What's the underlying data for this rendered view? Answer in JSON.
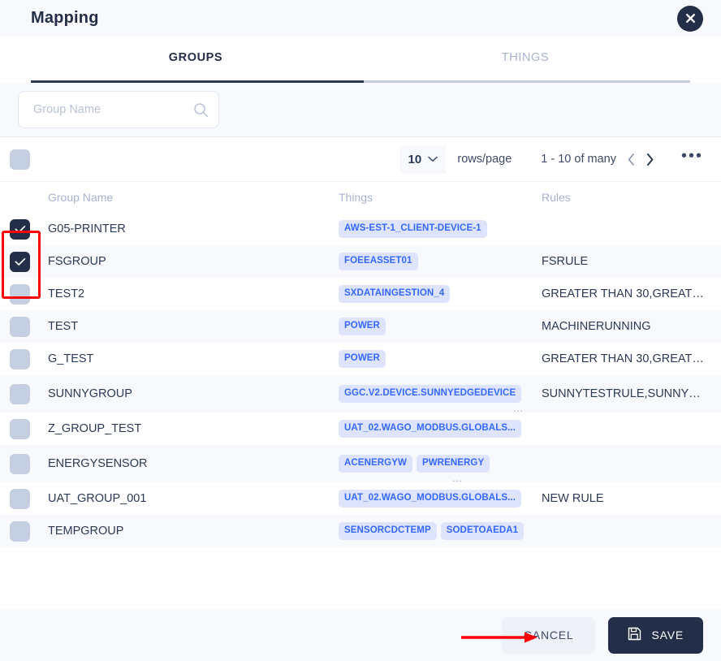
{
  "header": {
    "title": "Mapping",
    "close_icon": "close-icon"
  },
  "tabs": [
    {
      "label": "GROUPS",
      "active": true
    },
    {
      "label": "THINGS",
      "active": false
    }
  ],
  "search": {
    "placeholder": "Group Name",
    "value": "",
    "icon": "search-icon"
  },
  "toolbar": {
    "rows_per_page_value": "10",
    "rows_per_page_label": "rows/page",
    "page_range": "1 - 10 of many",
    "prev_icon": "chevron-left-icon",
    "next_icon": "chevron-right-icon",
    "more_icon": "ellipsis-icon",
    "more_label": "•••"
  },
  "table": {
    "columns": [
      "Group Name",
      "Things",
      "Rules"
    ],
    "rows": [
      {
        "checked": true,
        "group": "G05-PRINTER",
        "things": [
          "AWS-EST-1_CLIENT-DEVICE-1"
        ],
        "overflow": false,
        "rules": ""
      },
      {
        "checked": true,
        "group": "FSGROUP",
        "things": [
          "FOEEASSET01"
        ],
        "overflow": false,
        "rules": "FSRULE"
      },
      {
        "checked": false,
        "group": "TEST2",
        "things": [
          "SXDATAINGESTION_4"
        ],
        "overflow": false,
        "rules": "GREATER THAN 30,GREATE..."
      },
      {
        "checked": false,
        "group": "TEST",
        "things": [
          "POWER"
        ],
        "overflow": false,
        "rules": "MACHINERUNNING"
      },
      {
        "checked": false,
        "group": "G_TEST",
        "things": [
          "POWER"
        ],
        "overflow": false,
        "rules": "GREATER THAN 30,GREATE..."
      },
      {
        "checked": false,
        "group": "SUNNYGROUP",
        "things": [
          "GGC.V2.DEVICE.SUNNYEDGEDEVICE"
        ],
        "overflow": true,
        "rules": "SUNNYTESTRULE,SUNNYTE..."
      },
      {
        "checked": false,
        "group": "Z_GROUP_TEST",
        "things": [
          "UAT_02.WAGO_MODBUS.GLOBALS..."
        ],
        "overflow": false,
        "rules": ""
      },
      {
        "checked": false,
        "group": "ENERGYSENSOR",
        "things": [
          "ACENERGYW",
          "PWRENERGY"
        ],
        "overflow": true,
        "rules": ""
      },
      {
        "checked": false,
        "group": "UAT_GROUP_001",
        "things": [
          "UAT_02.WAGO_MODBUS.GLOBALS..."
        ],
        "overflow": false,
        "rules": "NEW RULE"
      },
      {
        "checked": false,
        "group": "TEMPGROUP",
        "things": [
          "SENSORCDCTEMP",
          "SODETOAEDA1"
        ],
        "overflow": false,
        "rules": ""
      }
    ],
    "select_all_checked": false
  },
  "footer": {
    "cancel_label": "CANCEL",
    "save_label": "SAVE",
    "save_icon": "save-floppy-icon"
  },
  "annotations": {
    "highlight_color": "#ff0000",
    "checkbox_highlight": "selected-rows-checkbox-highlight",
    "arrow": "cancel-button-pointer-arrow"
  },
  "colors": {
    "dark_navy": "#232f48",
    "chip_bg": "#dde4fb",
    "chip_text": "#3568fb",
    "row_alt_bg": "#f7f9fc"
  }
}
